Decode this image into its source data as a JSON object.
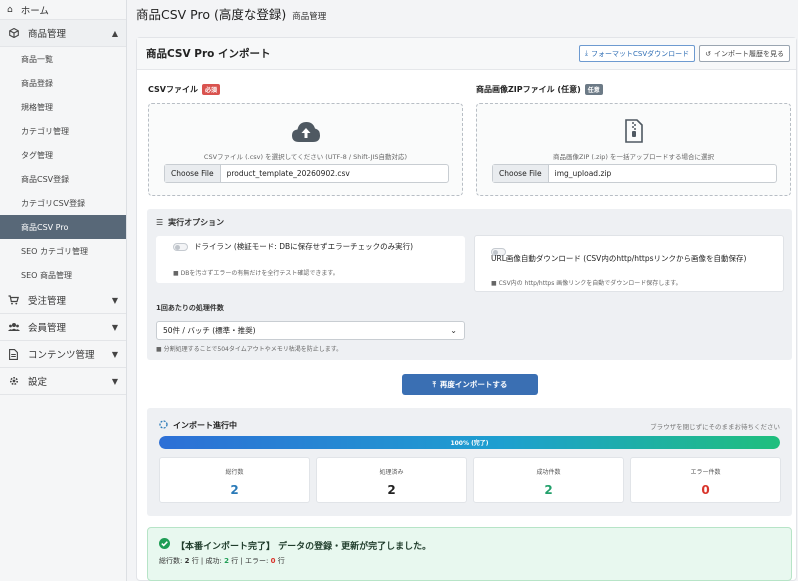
{
  "sidebar": {
    "home": "ホーム",
    "sections": [
      {
        "label": "商品管理",
        "icon": "cube-icon"
      },
      {
        "label": "受注管理",
        "icon": "cart-icon"
      },
      {
        "label": "会員管理",
        "icon": "users-icon"
      },
      {
        "label": "コンテンツ管理",
        "icon": "file-icon"
      },
      {
        "label": "設定",
        "icon": "gear-icon"
      }
    ],
    "items": [
      "商品一覧",
      "商品登録",
      "規格管理",
      "カテゴリ管理",
      "タグ管理",
      "商品CSV登録",
      "カテゴリCSV登録",
      "商品CSV Pro",
      "SEO カテゴリ管理",
      "SEO 商品管理"
    ],
    "active_item": "商品CSV Pro"
  },
  "header": {
    "title": "商品CSV Pro (高度な登録)",
    "subtitle": "商品管理"
  },
  "panel": {
    "title": "商品CSV Pro インポート",
    "format_button": "フォーマットCSVダウンロード",
    "history_button": "インポート履歴を見る"
  },
  "csv_field": {
    "label": "CSVファイル",
    "badge": "必須",
    "hint": "CSVファイル (.csv) を選択してください (UTF-8 / Shift-JIS自動対応)",
    "choose_label": "Choose File",
    "filename": "product_template_20260902.csv"
  },
  "zip_field": {
    "label": "商品画像ZIPファイル (任意)",
    "badge": "任意",
    "hint": "商品画像ZIP (.zip) を一括アップロードする場合に選択",
    "choose_label": "Choose File",
    "filename": "img_upload.zip"
  },
  "options": {
    "title": "実行オプション",
    "dry_run_label": "ドライラン (検証モード: DBに保存せずエラーチェックのみ実行)",
    "dry_run_note": "DBを汚さずエラーの有無だけを全行テスト確認できます。",
    "url_label": "URL画像自動ダウンロード (CSV内のhttp/httpsリンクから画像を自動保存)",
    "url_note": "CSV内の http/https 画像リンクを自動でダウンロード保存します。",
    "batch_label": "1回あたりの処理件数",
    "batch_value": "50件 / バッチ (標準・推奨)",
    "batch_note": "分割処理することで504タイムアウトやメモリ枯渇を防止します。"
  },
  "reimport_button": "再度インポートする",
  "progress": {
    "title": "インポート進行中",
    "right_note": "ブラウザを閉じずにそのままお待ちください",
    "percent": 100,
    "bar_label": "100% (完了)",
    "stats": [
      {
        "label": "総行数",
        "value": "2",
        "color": "#2a7ab8"
      },
      {
        "label": "処理済み",
        "value": "2",
        "color": "#222222"
      },
      {
        "label": "成功件数",
        "value": "2",
        "color": "#22a06b"
      },
      {
        "label": "エラー件数",
        "value": "0",
        "color": "#d9342b"
      }
    ]
  },
  "success": {
    "title": "【本番インポート完了】 データの登録・更新が完了しました。",
    "total_label": "総行数:",
    "total_value": "2",
    "total_unit": "行 | 成功:",
    "success_value": "2",
    "success_unit": "行 | エラー:",
    "error_value": "0",
    "error_unit": "行"
  }
}
